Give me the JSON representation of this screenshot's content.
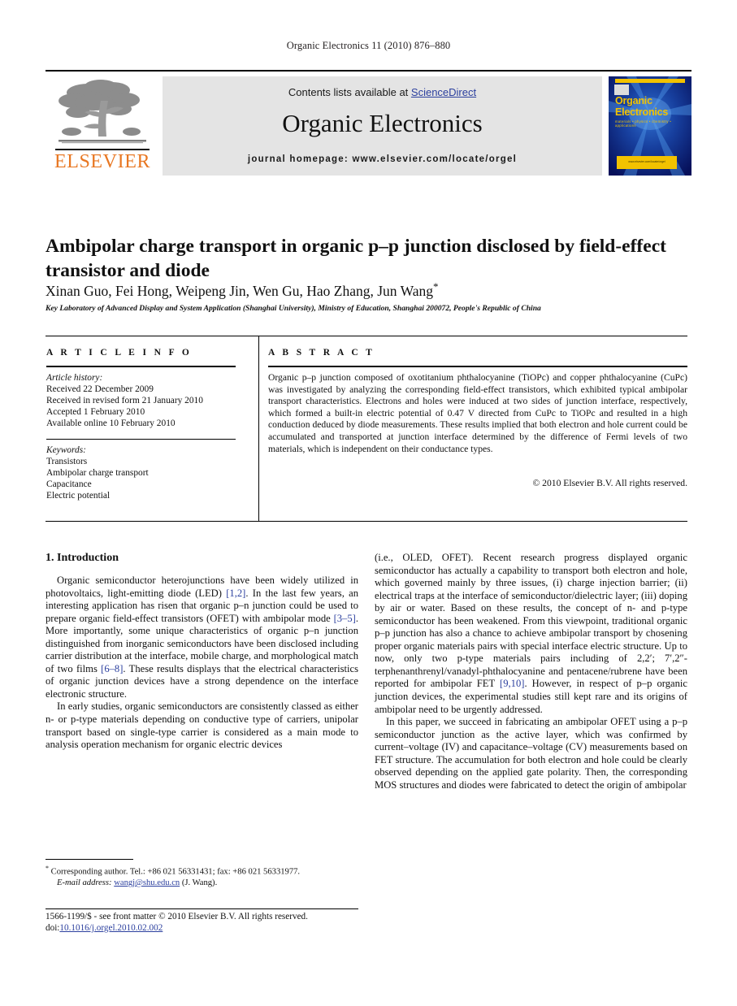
{
  "running_head": "Organic Electronics 11 (2010) 876–880",
  "masthead": {
    "contents_text": "Contents lists available at ",
    "sciencedirect": "ScienceDirect",
    "journal_name": "Organic Electronics",
    "homepage": "journal homepage: www.elsevier.com/locate/orgel",
    "publisher_logo_text": "ELSEVIER",
    "cover": {
      "title_line1": "Organic",
      "title_line2": "Electronics",
      "subtitle": "materials  •  physics  •  chemistry  •  applications",
      "footer_text": "www.elsevier.com/locate/orgel"
    }
  },
  "article": {
    "title": "Ambipolar charge transport in organic p–p junction disclosed by field-effect transistor and diode",
    "authors": "Xinan Guo, Fei Hong, Weipeng Jin, Wen Gu, Hao Zhang, Jun Wang",
    "author_star": "*",
    "affiliation": "Key Laboratory of Advanced Display and System Application (Shanghai University), Ministry of Education, Shanghai 200072, People's Republic of China"
  },
  "info": {
    "heading": "A R T I C L E  I N F O",
    "history_label": "Article history:",
    "history": [
      "Received 22 December 2009",
      "Received in revised form 21 January 2010",
      "Accepted 1 February 2010",
      "Available online 10 February 2010"
    ],
    "keywords_label": "Keywords:",
    "keywords": [
      "Transistors",
      "Ambipolar charge transport",
      "Capacitance",
      "Electric potential"
    ]
  },
  "abstract": {
    "heading": "A B S T R A C T",
    "text": "Organic p–p junction composed of oxotitanium phthalocyanine (TiOPc) and copper phthalocyanine (CuPc) was investigated by analyzing the corresponding field-effect transistors, which exhibited typical ambipolar transport characteristics. Electrons and holes were induced at two sides of junction interface, respectively, which formed a built-in electric potential of 0.47 V directed from CuPc to TiOPc and resulted in a high conduction deduced by diode measurements. These results implied that both electron and hole current could be accumulated and transported at junction interface determined by the difference of Fermi levels of two materials, which is independent on their conductance types.",
    "copyright": "© 2010 Elsevier B.V. All rights reserved."
  },
  "body": {
    "section_heading": "1. Introduction",
    "left_p1_a": "Organic semiconductor heterojunctions have been widely utilized in photovoltaics, light-emitting diode (LED) ",
    "left_p1_ref1": "[1,2]",
    "left_p1_b": ". In the last few years, an interesting application has risen that organic p–n junction could be used to prepare organic field-effect transistors (OFET) with ambipolar mode ",
    "left_p1_ref2": "[3–5]",
    "left_p1_c": ". More importantly, some unique characteristics of organic p–n junction distinguished from inorganic semiconductors have been disclosed including carrier distribution at the interface, mobile charge, and morphological match of two films ",
    "left_p1_ref3": "[6–8]",
    "left_p1_d": ". These results displays that the electrical characteristics of organic junction devices have a strong dependence on the interface electronic structure.",
    "left_p2": "In early studies, organic semiconductors are consistently classed as either n- or p-type materials depending on conductive type of carriers, unipolar transport based on single-type carrier is considered as a main mode to analysis operation mechanism for organic electric devices",
    "right_p1_a": "(i.e., OLED, OFET). Recent research progress displayed organic semiconductor has actually a capability to transport both electron and hole, which governed mainly by three issues, (i) charge injection barrier; (ii) electrical traps at the interface of semiconductor/dielectric layer; (iii) doping by air or water. Based on these results, the concept of n- and p-type semiconductor has been weakened. From this viewpoint, traditional organic p–p junction has also a chance to achieve ambipolar transport by chosening proper organic materials pairs with special interface electric structure. Up to now, only two p-type materials pairs including of 2,2′; 7′,2″-terphenanthrenyl/vanadyl-phthalocyanine and pentacene/rubrene have been reported for ambipolar FET ",
    "right_p1_ref": "[9,10]",
    "right_p1_b": ". However, in respect of p–p organic junction devices, the experimental studies still kept rare and its origins of ambipolar need to be urgently addressed.",
    "right_p2": "In this paper, we succeed in fabricating an ambipolar OFET using a p–p semiconductor junction as the active layer, which was confirmed by current–voltage (IV) and capacitance–voltage (CV) measurements based on FET structure. The accumulation for both electron and hole could be clearly observed depending on the applied gate polarity. Then, the corresponding MOS structures and diodes were fabricated to detect the origin of ambipolar"
  },
  "footnote": {
    "star": "*",
    "text": " Corresponding author. Tel.: +86 021 56331431; fax: +86 021 56331977.",
    "email_label": "E-mail address:",
    "email": "wangj@shu.edu.cn",
    "email_suffix": " (J. Wang)."
  },
  "footer": {
    "line1": "1566-1199/$ - see front matter © 2010 Elsevier B.V. All rights reserved.",
    "doi_label": "doi:",
    "doi": "10.1016/j.orgel.2010.02.002"
  }
}
